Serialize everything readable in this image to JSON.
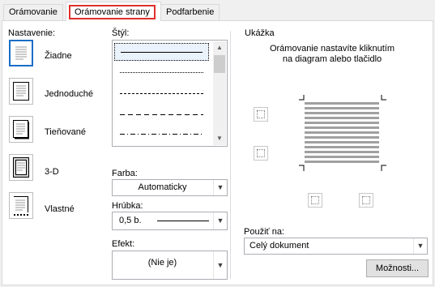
{
  "tabs": [
    {
      "label": "Orámovanie",
      "access": "O"
    },
    {
      "label": "Orámovanie strany",
      "access": "O"
    },
    {
      "label": "Podfarbenie",
      "access": "b"
    }
  ],
  "setting": {
    "heading": "Nastavenie:",
    "presets": [
      {
        "label": "Žiadne",
        "selected": true
      },
      {
        "label": "Jednoduché",
        "selected": false
      },
      {
        "label": "Tieňované",
        "selected": false
      },
      {
        "label": "3-D",
        "selected": false
      },
      {
        "label": "Vlastné",
        "selected": false
      }
    ]
  },
  "style": {
    "heading": "Štýl:",
    "items": [
      "solid",
      "dotted",
      "dashed-short",
      "dashed-long",
      "dash-dot"
    ]
  },
  "color": {
    "heading": "Farba:",
    "value": "Automaticky"
  },
  "width": {
    "heading": "Hrúbka:",
    "value": "0,5 b."
  },
  "art": {
    "heading": "Efekt:",
    "value": "(Nie je)"
  },
  "preview": {
    "heading": "Ukážka",
    "instructions": "Orámovanie nastavíte kliknutím na diagram alebo tlačidlo"
  },
  "apply_to": {
    "heading": "Použiť na:",
    "value": "Celý dokument"
  },
  "options_button": "Možnosti...",
  "colors": {
    "accent": "#1a6ec8",
    "tab_highlight": "#e0302b"
  }
}
